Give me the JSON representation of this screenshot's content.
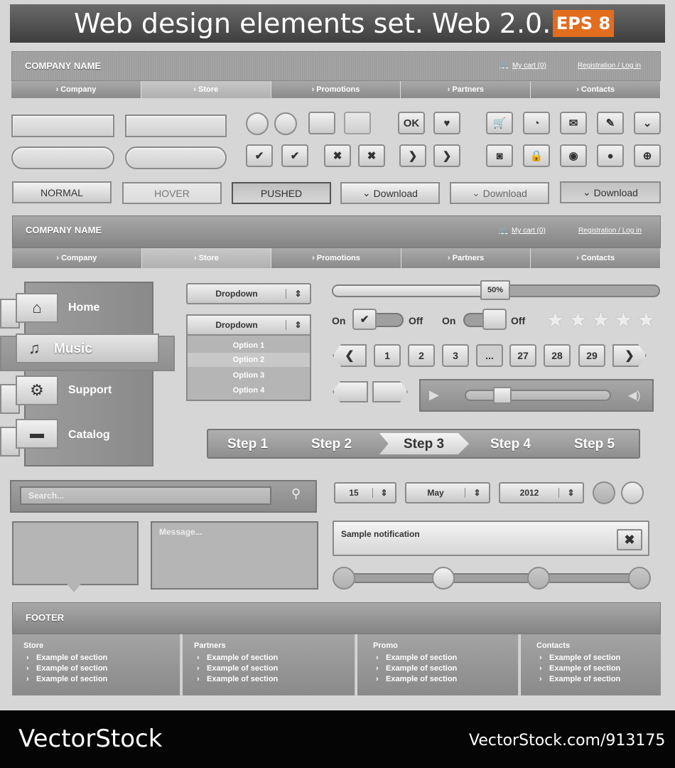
{
  "title": "Web design elements set. Web 2.0.",
  "eps_badge": "EPS 8",
  "header1": {
    "company": "COMPANY NAME",
    "cart": "My cart (0)",
    "register": "Registration / Log in"
  },
  "nav1": [
    "› Company",
    "› Store",
    "› Promotions",
    "› Partners",
    "› Contacts"
  ],
  "buttons_states": {
    "normal": "NORMAL",
    "hover": "HOVER",
    "pushed": "PUSHED",
    "download": "Download"
  },
  "ok_label": "OK",
  "header2": {
    "company": "COMPANY NAME",
    "cart": "My cart (0)",
    "register": "Registration / Log in"
  },
  "nav2": [
    "› Company",
    "› Store",
    "› Promotions",
    "› Partners",
    "› Contacts"
  ],
  "sidenav": [
    "Home",
    "Music",
    "Support",
    "Catalog"
  ],
  "dropdown1": "Dropdown",
  "dropdown2": {
    "label": "Dropdown",
    "options": [
      "Option 1",
      "Option 2",
      "Option 3",
      "Option 4"
    ]
  },
  "progress": {
    "label": "50%",
    "value": 0.5
  },
  "toggles": {
    "on": "On",
    "off": "Off"
  },
  "rating": {
    "stars": 5
  },
  "pagination": [
    "1",
    "2",
    "3",
    "...",
    "27",
    "28",
    "29"
  ],
  "steps": [
    "Step 1",
    "Step 2",
    "Step 3",
    "Step 4",
    "Step 5"
  ],
  "search_placeholder": "Search...",
  "message_placeholder": "Message...",
  "date": {
    "day": "15",
    "month": "May",
    "year": "2012"
  },
  "notification": "Sample notification",
  "footer": {
    "title": "FOOTER",
    "columns": [
      {
        "title": "Store",
        "items": [
          "Example of section",
          "Example of section",
          "Example of section"
        ]
      },
      {
        "title": "Partners",
        "items": [
          "Example of section",
          "Example of section",
          "Example of section"
        ]
      },
      {
        "title": "Promo",
        "items": [
          "Example of section",
          "Example of section",
          "Example of section"
        ]
      },
      {
        "title": "Contacts",
        "items": [
          "Example of section",
          "Example of section",
          "Example of section"
        ]
      }
    ]
  },
  "watermark": "VectorStock",
  "image_id": "VectorStock.com/913175"
}
